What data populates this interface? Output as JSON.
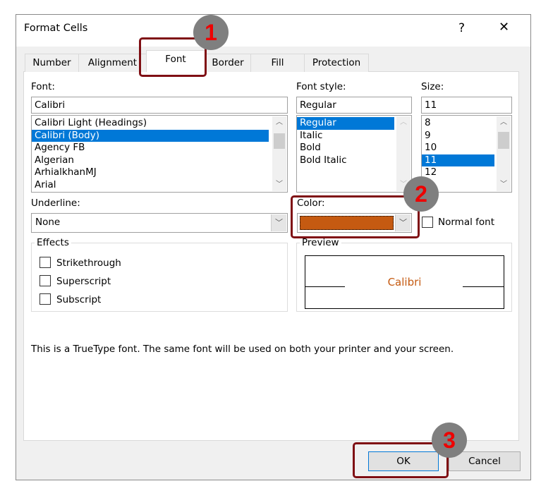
{
  "dialog": {
    "title": "Format Cells",
    "help": "?",
    "close": "✕"
  },
  "tabs": [
    "Number",
    "Alignment",
    "Font",
    "Border",
    "Fill",
    "Protection"
  ],
  "selected_tab": "Font",
  "font": {
    "label": "Font:",
    "value": "Calibri",
    "items": [
      "Calibri Light (Headings)",
      "Calibri (Body)",
      "Agency FB",
      "Algerian",
      "ArhialkhanMJ",
      "Arial"
    ],
    "selected": "Calibri (Body)"
  },
  "font_style": {
    "label": "Font style:",
    "value": "Regular",
    "items": [
      "Regular",
      "Italic",
      "Bold",
      "Bold Italic"
    ],
    "selected": "Regular"
  },
  "size": {
    "label": "Size:",
    "value": "11",
    "items": [
      "8",
      "9",
      "10",
      "11",
      "12"
    ],
    "selected": "11"
  },
  "underline": {
    "label": "Underline:",
    "value": "None"
  },
  "color": {
    "label": "Color:",
    "value": "#C55A11"
  },
  "normal_font": {
    "label": "Normal font",
    "checked": false
  },
  "effects": {
    "label": "Effects",
    "items": [
      {
        "label": "Strikethrough",
        "checked": false
      },
      {
        "label": "Superscript",
        "checked": false
      },
      {
        "label": "Subscript",
        "checked": false
      }
    ]
  },
  "preview": {
    "label": "Preview",
    "text": "Calibri",
    "color": "#C55A11"
  },
  "info": "This is a TrueType font.  The same font will be used on both your printer and your screen.",
  "buttons": {
    "ok": "OK",
    "cancel": "Cancel"
  },
  "annotations": [
    "1",
    "2",
    "3"
  ],
  "colors": {
    "highlight": "#7f0f14",
    "selection": "#0078d7"
  }
}
